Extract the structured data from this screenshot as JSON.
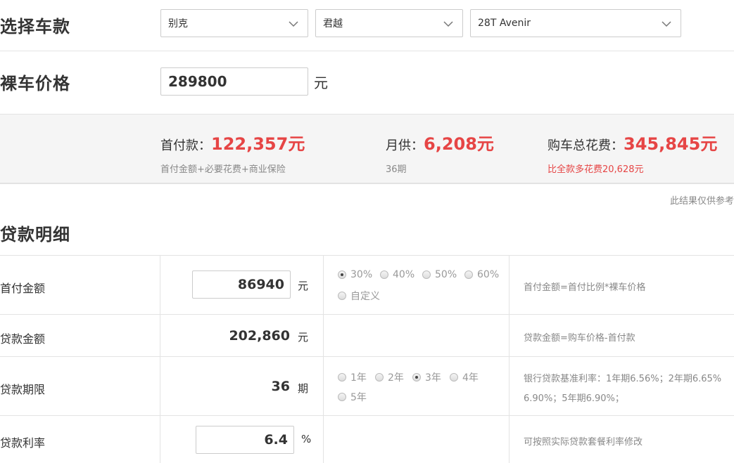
{
  "select_car": {
    "title": "选择车款",
    "brand": "别克",
    "series": "君越",
    "model": "28T Avenir"
  },
  "bare_price": {
    "title": "裸车价格",
    "value": "289800",
    "unit": "元"
  },
  "summary": {
    "down_payment_label": "首付款：",
    "down_payment_value": "122,357元",
    "down_payment_note": "首付金额+必要花费+商业保险",
    "monthly_label": "月供：",
    "monthly_value": "6,208元",
    "monthly_note": "36期",
    "total_label": "购车总花费：",
    "total_value": "345,845元",
    "total_note": "比全款多花费20,628元"
  },
  "disclaimer": "此结果仅供参考",
  "loan_detail": {
    "title": "贷款明细",
    "rows": [
      {
        "label": "首付金额",
        "value": "86940",
        "unit": "元",
        "options": [
          "30%",
          "40%",
          "50%",
          "60%",
          "自定义"
        ],
        "selected": "30%",
        "hint": "首付金额=首付比例*裸车价格"
      },
      {
        "label": "贷款金额",
        "value": "202,860",
        "unit": "元",
        "hint": "贷款金额=购车价格-首付款"
      },
      {
        "label": "贷款期限",
        "value": "36",
        "unit": "期",
        "options": [
          "1年",
          "2年",
          "3年",
          "4年",
          "5年"
        ],
        "selected": "3年",
        "hint_line1": "银行贷款基准利率：1年期6.56%；2年期6.65%",
        "hint_line2": "6.90%；5年期6.90%；"
      },
      {
        "label": "贷款利率",
        "value": "6.4",
        "unit": "%",
        "hint": "可按照实际贷款套餐利率修改"
      }
    ]
  }
}
